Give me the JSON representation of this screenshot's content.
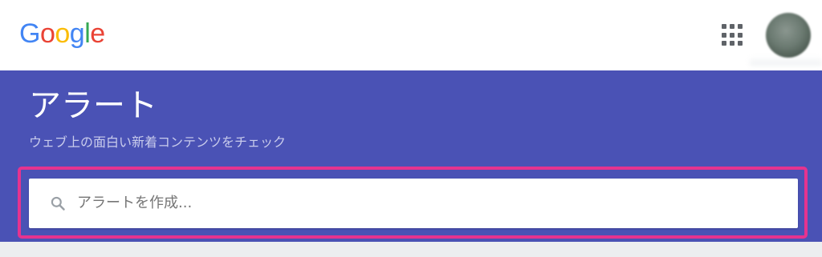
{
  "header": {
    "logo_letters": [
      {
        "ch": "G",
        "color": "#4285F4"
      },
      {
        "ch": "o",
        "color": "#EA4335"
      },
      {
        "ch": "o",
        "color": "#FBBC05"
      },
      {
        "ch": "g",
        "color": "#4285F4"
      },
      {
        "ch": "l",
        "color": "#34A853"
      },
      {
        "ch": "e",
        "color": "#EA4335"
      }
    ],
    "apps_icon": "apps-grid-icon",
    "avatar_icon": "account-avatar"
  },
  "page": {
    "title": "アラート",
    "subtitle": "ウェブ上の面白い新着コンテンツをチェック",
    "accent_color": "#4a52b5",
    "highlight_color": "#e5338f"
  },
  "search": {
    "placeholder": "アラートを作成...",
    "icon": "search-icon"
  }
}
